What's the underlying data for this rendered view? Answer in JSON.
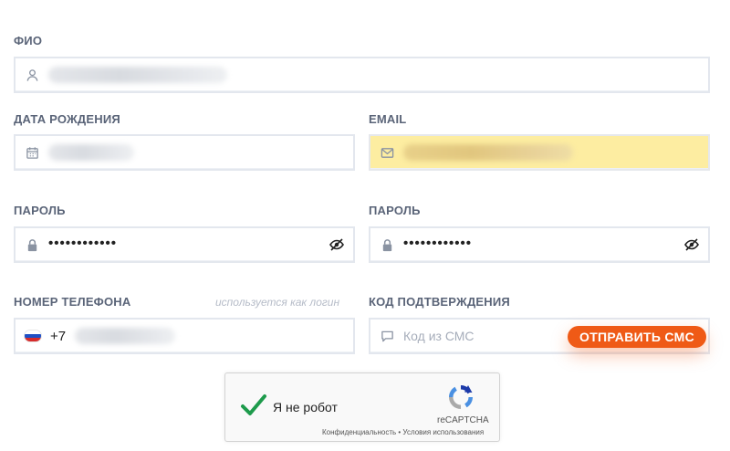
{
  "form": {
    "fio": {
      "label": "ФИО"
    },
    "birth_date": {
      "label": "ДАТА РОЖДЕНИЯ"
    },
    "email": {
      "label": "EMAIL"
    },
    "password": {
      "label": "ПАРОЛЬ",
      "value": "••••••••••••"
    },
    "password_confirm": {
      "label": "ПАРОЛЬ",
      "value": "••••••••••••"
    },
    "phone": {
      "label": "НОМЕР ТЕЛЕФОНА",
      "hint": "используется как логин",
      "prefix": "+7"
    },
    "sms_code": {
      "label": "КОД ПОДТВЕРЖДЕНИЯ",
      "placeholder": "Код из СМС",
      "send_button": "ОТПРАВИТЬ СМС"
    }
  },
  "recaptcha": {
    "label": "Я не робот",
    "brand": "reCAPTCHA",
    "privacy": "Конфиденциальность",
    "separator": " • ",
    "terms": "Условия использования"
  },
  "colors": {
    "accent": "#ef5a16",
    "email_highlight": "#fdeda1",
    "check_green": "#1e9b4c",
    "label_text": "#5a6478"
  },
  "icons": {
    "fio": "user-icon",
    "birth_date": "calendar-icon",
    "email": "mail-icon",
    "password": "lock-icon",
    "visibility": "eye-off-icon",
    "phone_flag": "russia-flag-icon",
    "sms": "chat-bubble-icon",
    "captcha_check": "checkmark-icon",
    "captcha_logo": "recaptcha-logo-icon"
  }
}
